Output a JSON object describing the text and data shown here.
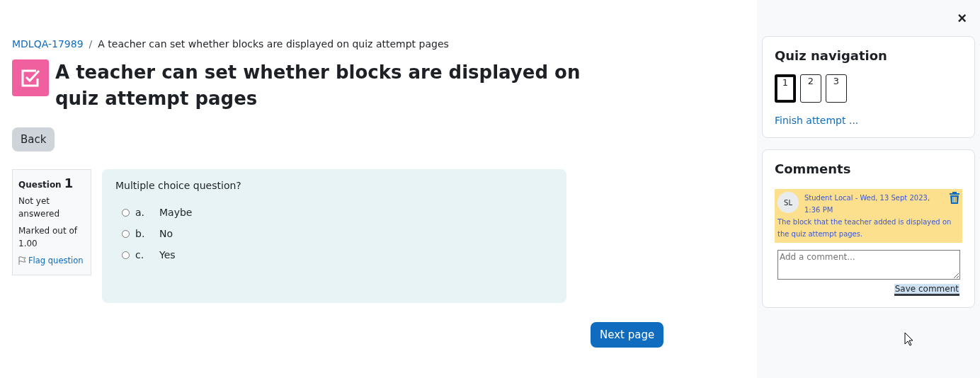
{
  "breadcrumb_separator": "/",
  "breadcrumb": [
    {
      "label": "MDLQA-17989",
      "link": true
    },
    {
      "label": "A teacher can set whether blocks are displayed on quiz attempt pages",
      "link": false
    }
  ],
  "title": "A teacher can set whether blocks are displayed on quiz attempt pages",
  "back_button": "Back",
  "question_info": {
    "label": "Question",
    "number": "1",
    "state": "Not yet answered",
    "marks": "Marked out of 1.00",
    "flag": "Flag question"
  },
  "question": {
    "text": "Multiple choice question?",
    "options": [
      {
        "letter": "a.",
        "label": "Maybe",
        "selected": false
      },
      {
        "letter": "b.",
        "label": "No",
        "selected": false
      },
      {
        "letter": "c.",
        "label": "Yes",
        "selected": false
      }
    ]
  },
  "next_button": "Next page",
  "drawer": {
    "close": "×"
  },
  "quiz_navigation": {
    "title": "Quiz navigation",
    "pages": [
      {
        "label": "1",
        "selected": true
      },
      {
        "label": "2",
        "selected": false
      },
      {
        "label": "3",
        "selected": false
      }
    ],
    "finish": "Finish attempt ..."
  },
  "comments": {
    "title": "Comments",
    "items": [
      {
        "initials": "SL",
        "meta": "Student Local - Wed, 13 Sept 2023, 1:36 PM",
        "text": "The block that the teacher added is displayed on the quiz attempt pages."
      }
    ],
    "placeholder": "Add a comment...",
    "save": "Save comment"
  }
}
